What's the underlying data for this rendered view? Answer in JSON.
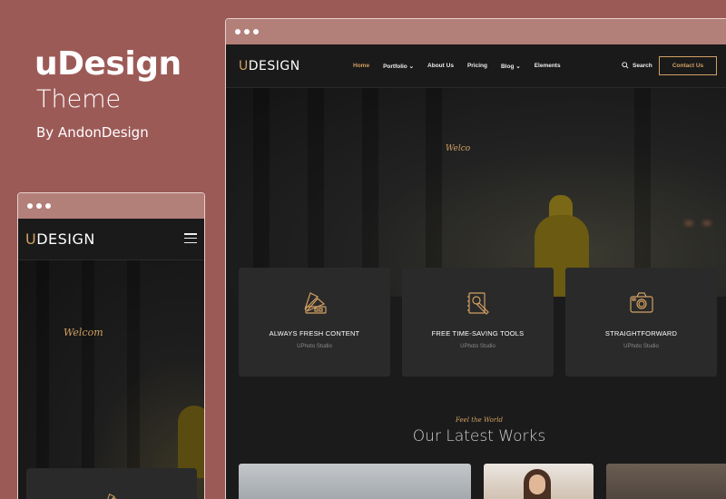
{
  "promo": {
    "title": "uDesign",
    "subtitle": "Theme",
    "byline": "By AndonDesign"
  },
  "colors": {
    "background": "#9c5a57",
    "accent": "#d1a063",
    "frame_bar": "#b37f79",
    "dark": "#1b1b1b",
    "card": "#2a2a2a"
  },
  "desktop": {
    "logo_u": "U",
    "logo_rest": "DESIGN",
    "nav": {
      "items": [
        {
          "label": "Home",
          "active": true
        },
        {
          "label": "Portfolio ⌄",
          "active": false
        },
        {
          "label": "About Us",
          "active": false
        },
        {
          "label": "Pricing",
          "active": false
        },
        {
          "label": "Blog ⌄",
          "active": false
        },
        {
          "label": "Elements",
          "active": false
        }
      ],
      "search_label": "Search",
      "contact_label": "Contact Us"
    },
    "hero_text": "Welco",
    "cards": [
      {
        "icon": "color-swatch-icon",
        "title": "ALWAYS FRESH CONTENT",
        "subtitle": "UPhoto Studio"
      },
      {
        "icon": "notebook-pen-icon",
        "title": "FREE TIME-SAVING TOOLS",
        "subtitle": "UPhoto Studio"
      },
      {
        "icon": "camera-icon",
        "title": "STRAIGHTFORWARD",
        "subtitle": "UPhoto Studio"
      }
    ],
    "works": {
      "tagline": "Feel the World",
      "title": "Our Latest Works"
    }
  },
  "mobile": {
    "logo_u": "U",
    "logo_rest": "DESIGN",
    "hero_text": "Welcom"
  }
}
